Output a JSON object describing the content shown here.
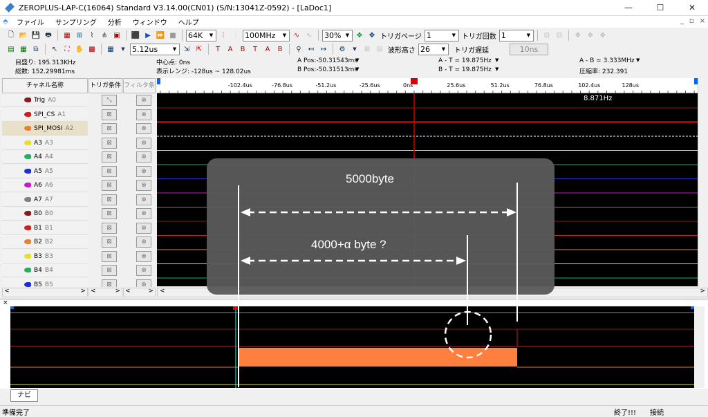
{
  "window": {
    "title": "ZEROPLUS-LAP-C(16064) Standard V3.14.00(CN01) (S/N:13041Z-0592) - [LaDoc1]",
    "min": "—",
    "max": "☐",
    "close": "✕"
  },
  "menu": [
    "ファイル",
    "サンプリング",
    "分析",
    "ウィンドウ",
    "ヘルプ"
  ],
  "mdi_controls": [
    "_",
    "▫",
    "×"
  ],
  "toolbar1": {
    "memory": "64K",
    "rate": "100MHz",
    "trigger_pos": "30%",
    "trigger_page_label": "トリガページ",
    "trigger_page": "1",
    "trigger_count_label": "トリガ回数",
    "trigger_count": "1"
  },
  "toolbar2": {
    "scale": "5.12us",
    "wave_height_label": "波形高さ",
    "wave_height": "26",
    "trigger_delay_label": "トリガ遅延",
    "trigger_delay": "10ns"
  },
  "info": {
    "scale_freq": "目盛り: 195.313KHz",
    "total": "総数: 152.29981ms",
    "center": "中心点: 0ns",
    "display_range": "表示レンジ: -128us ~ 128.02us",
    "a_pos": "A Pos:-50.31543ms",
    "b_pos": "B Pos:-50.31513ms",
    "a_t": "A - T = 19.875Hz",
    "b_t": "B - T = 19.875Hz",
    "a_b": "A - B = 3.333MHz",
    "compress": "圧縮率: 232.391"
  },
  "headers": {
    "channel_name": "チャネル名称",
    "trigger_cond": "トリガ条件",
    "filter_cond": "フィルタ条件"
  },
  "channels": [
    {
      "name": "Trig",
      "sub": "A0",
      "color": "#8b1a1a"
    },
    {
      "name": "SPI_CS",
      "sub": "A1",
      "color": "#cc2020"
    },
    {
      "name": "SPI_MOSI",
      "sub": "A2",
      "color": "#e8803a"
    },
    {
      "name": "A3",
      "sub": "A3",
      "color": "#e8e020"
    },
    {
      "name": "A4",
      "sub": "A4",
      "color": "#20b060"
    },
    {
      "name": "A5",
      "sub": "A5",
      "color": "#2030d0"
    },
    {
      "name": "A6",
      "sub": "A6",
      "color": "#c020c0"
    },
    {
      "name": "A7",
      "sub": "A7",
      "color": "#808080"
    },
    {
      "name": "B0",
      "sub": "B0",
      "color": "#8b1a1a"
    },
    {
      "name": "B1",
      "sub": "B1",
      "color": "#cc2020"
    },
    {
      "name": "B2",
      "sub": "B2",
      "color": "#e8803a"
    },
    {
      "name": "B3",
      "sub": "B3",
      "color": "#e8e020"
    },
    {
      "name": "B4",
      "sub": "B4",
      "color": "#20b060"
    },
    {
      "name": "B5",
      "sub": "B5",
      "color": "#2030d0"
    }
  ],
  "ruler_ticks": [
    "-102.4us",
    "-76.8us",
    "-51.2us",
    "-25.6us",
    "0ns",
    "25.6us",
    "51.2us",
    "76.8us",
    "102.4us",
    "128us"
  ],
  "wave_label": "8.871Hz",
  "overlay": {
    "total_label": "5000byte",
    "partial_label": "4000+α byte ?"
  },
  "nav_tab": "ナビ",
  "status": {
    "ready": "準備完了",
    "done": "終了!!!",
    "connected": "接続"
  }
}
